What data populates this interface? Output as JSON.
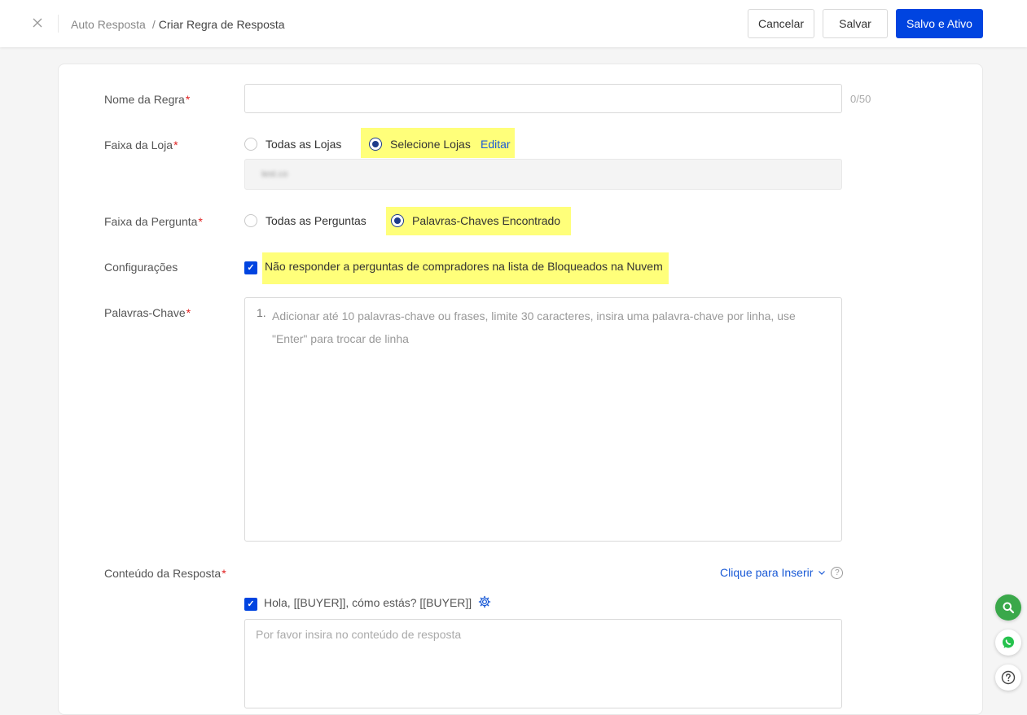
{
  "header": {
    "breadcrumb_parent": "Auto Resposta",
    "breadcrumb_separator": "/",
    "breadcrumb_current": "Criar Regra de Resposta",
    "cancel_label": "Cancelar",
    "save_label": "Salvar",
    "save_active_label": "Salvo e Ativo"
  },
  "form": {
    "rule_name": {
      "label": "Nome da Regra",
      "value": "",
      "counter": "0/50"
    },
    "store_range": {
      "label": "Faixa da Loja",
      "options": [
        "Todas as Lojas",
        "Selecione Lojas"
      ],
      "selected": "Selecione Lojas",
      "edit_label": "Editar",
      "selected_store": "test.co"
    },
    "question_range": {
      "label": "Faixa da Pergunta",
      "options": [
        "Todas as Perguntas",
        "Palavras-Chaves Encontrado"
      ],
      "selected": "Palavras-Chaves Encontrado"
    },
    "settings": {
      "label": "Configurações",
      "checkbox_label": "Não responder a perguntas de compradores na lista de Bloqueados na Nuvem",
      "checked": true
    },
    "keywords": {
      "label": "Palavras-Chave",
      "line_number": "1.",
      "placeholder": "Adicionar até 10 palavras-chave ou frases, limite 30 caracteres, insira uma palavra-chave por linha, use \"Enter\" para trocar de linha"
    },
    "response_content": {
      "label": "Conteúdo da Resposta",
      "insert_label": "Clique para Inserir",
      "greeting_label": "Hola, [[BUYER]], cómo estás? [[BUYER]]",
      "greeting_checked": true,
      "placeholder": "Por favor insira no conteúdo de resposta"
    }
  },
  "colors": {
    "primary": "#0044e0",
    "highlight": "#ffff7a",
    "link": "#1a5ad6",
    "required": "#e02020"
  },
  "floating": {
    "search_icon": "search-icon",
    "whatsapp_icon": "whatsapp-icon",
    "help_icon": "help-icon"
  }
}
